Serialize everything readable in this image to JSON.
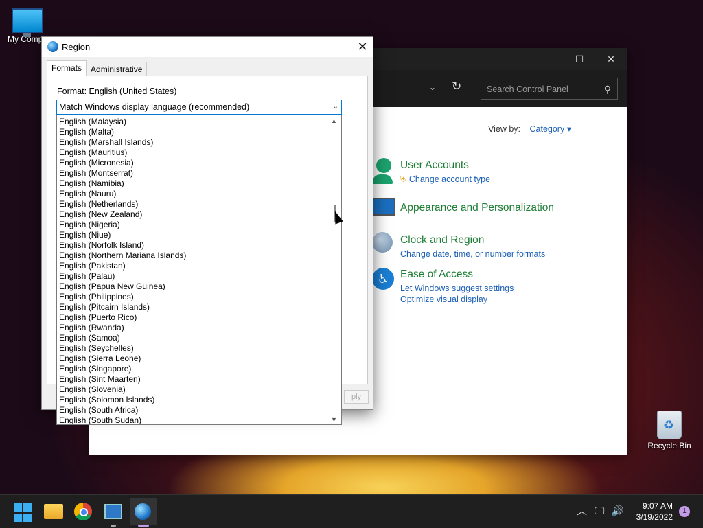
{
  "desktop": {
    "icons": [
      {
        "label": "My Compu"
      },
      {
        "label": "Recycle Bin"
      }
    ]
  },
  "control_panel": {
    "search_placeholder": "Search Control Panel",
    "view_by_label": "View by:",
    "view_by_value": "Category",
    "categories": [
      {
        "title": "User Accounts",
        "links": [
          "Change account type"
        ]
      },
      {
        "title": "Appearance and Personalization",
        "links": []
      },
      {
        "title": "Clock and Region",
        "links": [
          "Change date, time, or number formats"
        ]
      },
      {
        "title": "Ease of Access",
        "links": [
          "Let Windows suggest settings",
          "Optimize visual display"
        ]
      }
    ]
  },
  "region_dialog": {
    "title": "Region",
    "tabs": [
      "Formats",
      "Administrative"
    ],
    "format_label": "Format: English (United States)",
    "combo_value": "Match Windows display language (recommended)",
    "apply_partial": "ply",
    "options": [
      "English (Malaysia)",
      "English (Malta)",
      "English (Marshall Islands)",
      "English (Mauritius)",
      "English (Micronesia)",
      "English (Montserrat)",
      "English (Namibia)",
      "English (Nauru)",
      "English (Netherlands)",
      "English (New Zealand)",
      "English (Nigeria)",
      "English (Niue)",
      "English (Norfolk Island)",
      "English (Northern Mariana Islands)",
      "English (Pakistan)",
      "English (Palau)",
      "English (Papua New Guinea)",
      "English (Philippines)",
      "English (Pitcairn Islands)",
      "English (Puerto Rico)",
      "English (Rwanda)",
      "English (Samoa)",
      "English (Seychelles)",
      "English (Sierra Leone)",
      "English (Singapore)",
      "English (Sint Maarten)",
      "English (Slovenia)",
      "English (Solomon Islands)",
      "English (South Africa)",
      "English (South Sudan)"
    ]
  },
  "taskbar": {
    "time": "9:07 AM",
    "date": "3/19/2022",
    "notification_count": "1"
  },
  "colors": {
    "accent": "#0078d4",
    "category_title": "#1e7d34",
    "link": "#1a5fb4"
  }
}
